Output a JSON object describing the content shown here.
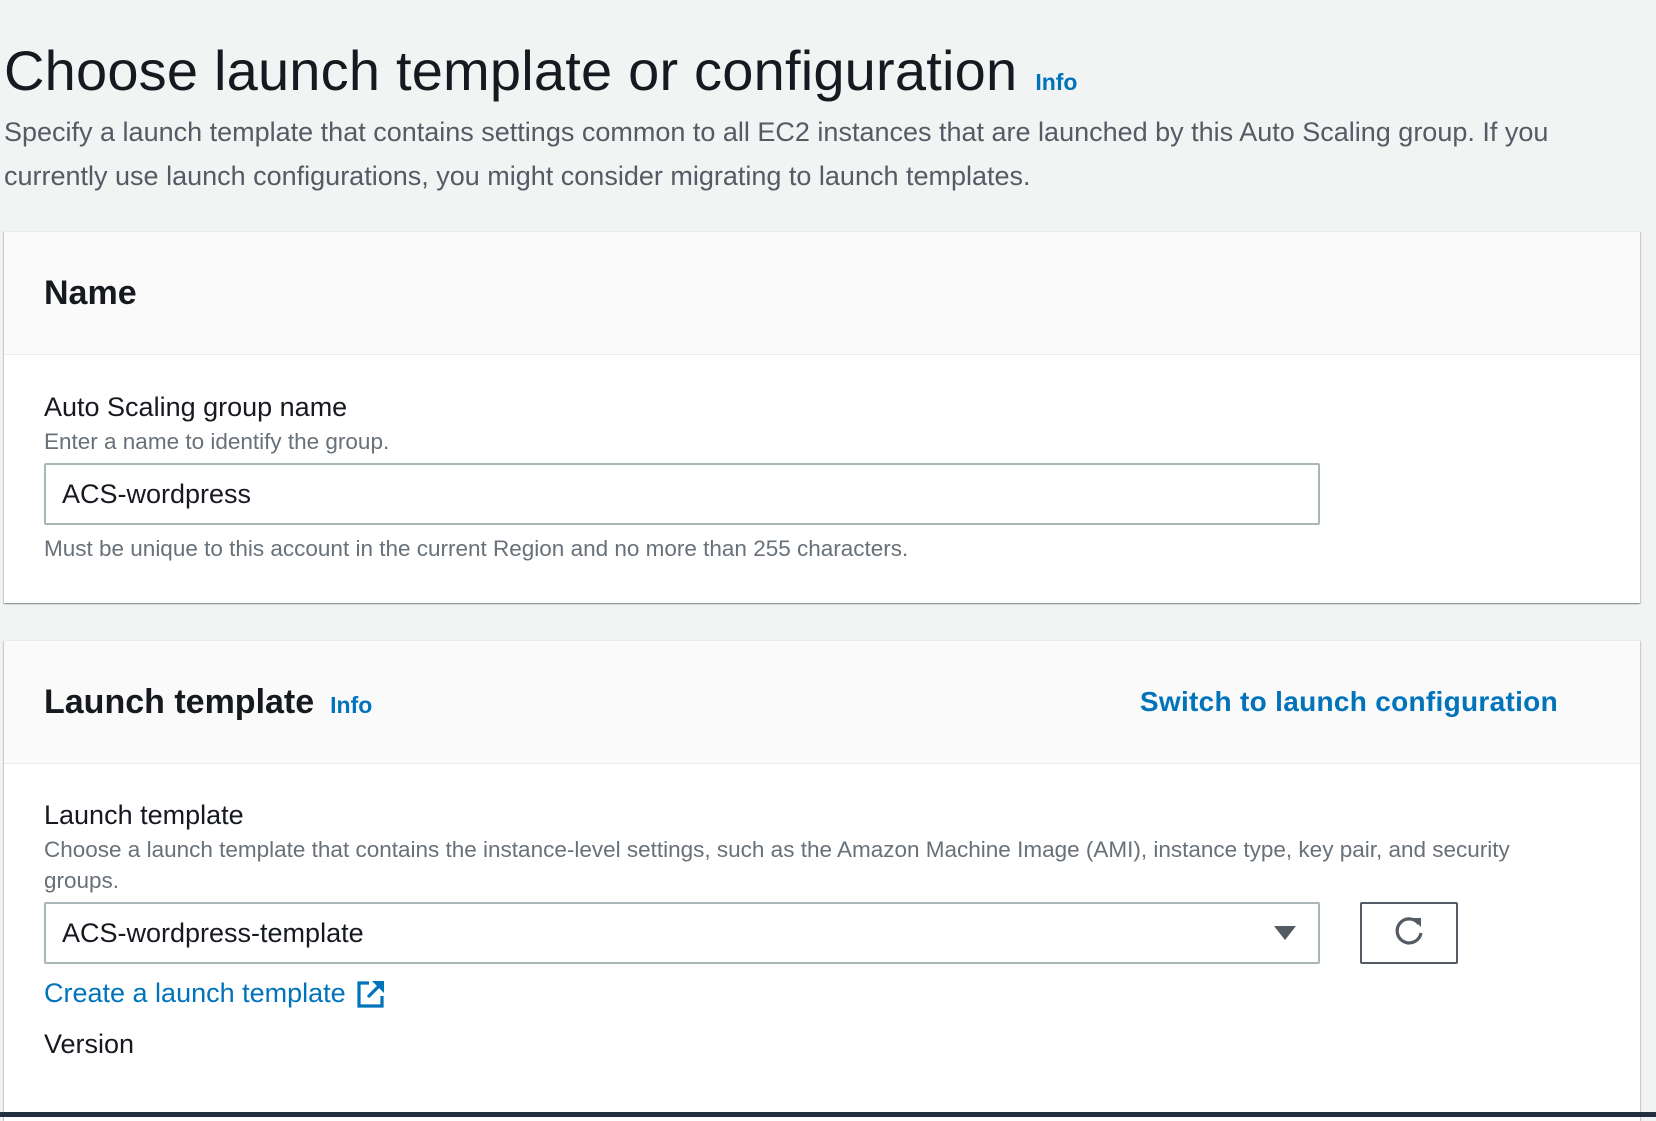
{
  "page": {
    "title": "Choose launch template or configuration",
    "info_label": "Info",
    "description": "Specify a launch template that contains settings common to all EC2 instances that are launched by this Auto Scaling group. If you currently use launch configurations, you might consider migrating to launch templates."
  },
  "name_section": {
    "title": "Name",
    "field_label": "Auto Scaling group name",
    "field_description": "Enter a name to identify the group.",
    "input_value": "ACS-wordpress",
    "constraint": "Must be unique to this account in the current Region and no more than 255 characters."
  },
  "launch_template_section": {
    "title": "Launch template",
    "info_label": "Info",
    "switch_link": "Switch to launch configuration",
    "field_label": "Launch template",
    "field_description": "Choose a launch template that contains the instance-level settings, such as the Amazon Machine Image (AMI), instance type, key pair, and security groups.",
    "selected_value": "ACS-wordpress-template",
    "create_link": "Create a launch template",
    "version_label": "Version",
    "icons": {
      "dropdown": "caret-down-icon",
      "refresh": "refresh-icon",
      "external": "external-link-icon"
    }
  },
  "colors": {
    "link": "#0073bb",
    "background": "#f2f3f3",
    "text": "#16191f",
    "secondary_text": "#687078"
  }
}
